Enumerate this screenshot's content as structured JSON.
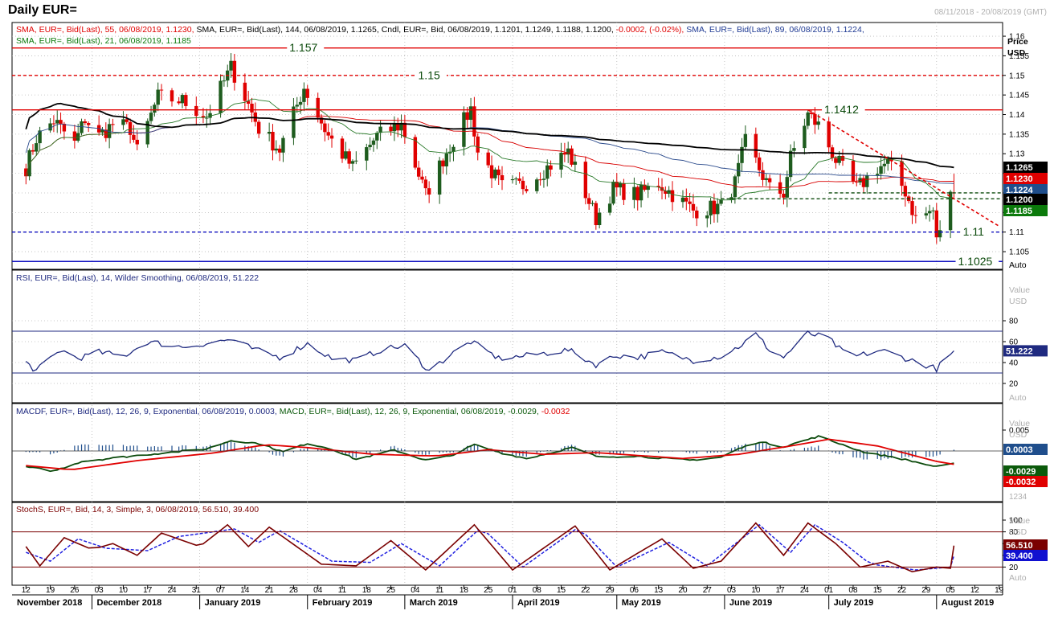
{
  "window": {
    "title": "Daily EUR=",
    "date_range": "08/11/2018 - 20/08/2019 (GMT)"
  },
  "legends": {
    "price_line1": [
      {
        "text": "SMA, EUR=, Bid(Last),  55, 06/08/2019, 1.1230,",
        "color": "#e00000"
      },
      {
        "text": "SMA, EUR=, Bid(Last),  144, 06/08/2019, 1.1265,",
        "color": "#000000"
      },
      {
        "text": "Cndl, EUR=, Bid, 06/08/2019, 1.1201, 1.1249, 1.1188, 1.1200,",
        "color": "#000000"
      },
      {
        "text": "-0.0002, (-0.02%),",
        "color": "#e00000"
      },
      {
        "text": "SMA, EUR=, Bid(Last),  89, 06/08/2019, 1.1224,",
        "color": "#1f3a93"
      }
    ],
    "price_line2": "SMA, EUR=, Bid(Last),  21, 06/08/2019, 1.1185",
    "rsi": "RSI, EUR=, Bid(Last),  14, Wilder Smoothing, 06/08/2019, 51.222",
    "macd": [
      {
        "text": "MACDF, EUR=, Bid(Last),  12, 26, 9, Exponential, 06/08/2019, 0.0003,",
        "color": "#1f2a80"
      },
      {
        "text": "MACD, EUR=, Bid(Last),  12, 26, 9, Exponential, 06/08/2019,",
        "color": "#0b5a0b"
      },
      {
        "text": "-0.0029,",
        "color": "#0b5a0b"
      },
      {
        "text": "-0.0032",
        "color": "#e00000"
      }
    ],
    "stoch": "StochS, EUR=, Bid,  14, 3, Simple, 3, 06/08/2019, 56.510, 39.400"
  },
  "axis_labels": {
    "price_header": [
      "Price",
      "USD"
    ],
    "value_header": [
      "Value",
      "USD"
    ],
    "auto": "Auto"
  },
  "price_ticks": [
    "1.16",
    "1.155",
    "1.15",
    "1.145",
    "1.14",
    "1.135",
    "1.13",
    "1.125",
    "1.12",
    "1.115",
    "1.11",
    "1.105"
  ],
  "rsi_ticks": [
    "80",
    "60",
    "40",
    "20"
  ],
  "macd_ticks": [
    "0.005",
    "1234"
  ],
  "stoch_ticks": [
    "100",
    "80",
    "60",
    "40",
    "20"
  ],
  "tags": {
    "sma144": {
      "text": "1.1265",
      "bg": "#000000",
      "fg": "#ffffff"
    },
    "sma55": {
      "text": "1.1230",
      "bg": "#e00000",
      "fg": "#ffffff"
    },
    "sma89": {
      "text": "1.1224",
      "bg": "#1f4e8c",
      "fg": "#ffffff"
    },
    "close": {
      "text": "1.1200",
      "bg": "#000000",
      "fg": "#ffffff"
    },
    "sma21": {
      "text": "1.1185",
      "bg": "#0b7a0b",
      "fg": "#ffffff"
    },
    "rsi": {
      "text": "51.222",
      "bg": "#1f2a80",
      "fg": "#ffffff"
    },
    "macdf": {
      "text": "0.0003",
      "bg": "#1f4e8c",
      "fg": "#ffffff"
    },
    "macd": {
      "text": "-0.0029",
      "bg": "#0b5a0b",
      "fg": "#ffffff"
    },
    "signal": {
      "text": "-0.0032",
      "bg": "#e00000",
      "fg": "#ffffff"
    },
    "stoch_k": {
      "text": "56.510",
      "bg": "#7a0000",
      "fg": "#ffffff"
    },
    "stoch_d": {
      "text": "39.400",
      "bg": "#1010d0",
      "fg": "#ffffff"
    }
  },
  "level_labels": {
    "l1157": "1.157",
    "l115": "1.15",
    "l11412": "1.1412",
    "l111": "1.11",
    "l11025": "1.1025"
  },
  "x_axis": {
    "days": [
      "12",
      "19",
      "26",
      "03",
      "10",
      "17",
      "24",
      "31",
      "07",
      "14",
      "21",
      "28",
      "04",
      "11",
      "18",
      "25",
      "04",
      "11",
      "18",
      "25",
      "01",
      "08",
      "15",
      "22",
      "29",
      "06",
      "13",
      "20",
      "27",
      "03",
      "10",
      "17",
      "24",
      "01",
      "08",
      "15",
      "22",
      "29",
      "05",
      "12",
      "19"
    ],
    "months": [
      "November 2018",
      "December 2018",
      "January 2019",
      "February 2019",
      "March 2019",
      "April 2019",
      "May 2019",
      "June 2019",
      "July 2019",
      "August 2019"
    ]
  },
  "colors": {
    "up": "#1e5c1e",
    "down": "#e00000",
    "sma144": "#000000",
    "sma55": "#d80000",
    "sma89": "#2a4a8c",
    "sma21": "#2a7a2a",
    "level": "#e00000",
    "support": "#1010c0",
    "rsi": "#1f2a80",
    "macd": "#0b4a0b",
    "signal": "#e00000",
    "hist": "#1f4e8c",
    "stoch_k": "#7a0000",
    "stoch_d": "#2020e0",
    "grid": "#b8b8b8"
  },
  "chart_data": [
    {
      "type": "candlestick",
      "title": "Daily EUR=",
      "ylabel": "Price USD",
      "ylim": [
        1.1005,
        1.1635
      ],
      "x_range": [
        "08/11/2018",
        "20/08/2019"
      ],
      "anchors_close": [
        [
          "2018-11-12",
          1.1265
        ],
        [
          "2018-11-15",
          1.134
        ],
        [
          "2018-11-20",
          1.1385
        ],
        [
          "2018-11-26",
          1.1325
        ],
        [
          "2018-11-29",
          1.139
        ],
        [
          "2018-12-03",
          1.1345
        ],
        [
          "2018-12-07",
          1.1375
        ],
        [
          "2018-12-12",
          1.1365
        ],
        [
          "2018-12-14",
          1.1305
        ],
        [
          "2018-12-20",
          1.1445
        ],
        [
          "2018-12-27",
          1.1435
        ],
        [
          "2019-01-03",
          1.1395
        ],
        [
          "2019-01-10",
          1.152
        ],
        [
          "2019-01-14",
          1.1445
        ],
        [
          "2019-01-18",
          1.1365
        ],
        [
          "2019-01-24",
          1.131
        ],
        [
          "2019-01-31",
          1.147
        ],
        [
          "2019-02-07",
          1.1345
        ],
        [
          "2019-02-14",
          1.1265
        ],
        [
          "2019-02-21",
          1.1345
        ],
        [
          "2019-02-28",
          1.1375
        ],
        [
          "2019-03-07",
          1.1195
        ],
        [
          "2019-03-13",
          1.1305
        ],
        [
          "2019-03-20",
          1.1415
        ],
        [
          "2019-03-22",
          1.1305
        ],
        [
          "2019-03-29",
          1.1215
        ],
        [
          "2019-04-04",
          1.122
        ],
        [
          "2019-04-11",
          1.1265
        ],
        [
          "2019-04-17",
          1.1305
        ],
        [
          "2019-04-25",
          1.1135
        ],
        [
          "2019-04-30",
          1.121
        ],
        [
          "2019-05-07",
          1.1195
        ],
        [
          "2019-05-13",
          1.1225
        ],
        [
          "2019-05-23",
          1.1155
        ],
        [
          "2019-05-31",
          1.1165
        ],
        [
          "2019-06-04",
          1.1225
        ],
        [
          "2019-06-07",
          1.133
        ],
        [
          "2019-06-14",
          1.121
        ],
        [
          "2019-06-18",
          1.12
        ],
        [
          "2019-06-20",
          1.129
        ],
        [
          "2019-06-25",
          1.14
        ],
        [
          "2019-06-28",
          1.1372
        ],
        [
          "2019-07-03",
          1.1285
        ],
        [
          "2019-07-09",
          1.121
        ],
        [
          "2019-07-15",
          1.1265
        ],
        [
          "2019-07-18",
          1.1275
        ],
        [
          "2019-07-23",
          1.1205
        ],
        [
          "2019-07-26",
          1.1135
        ],
        [
          "2019-07-31",
          1.1155
        ],
        [
          "2019-08-01",
          1.1075
        ],
        [
          "2019-08-02",
          1.1105
        ],
        [
          "2019-08-05",
          1.1203
        ],
        [
          "2019-08-06",
          1.12
        ]
      ],
      "last_candle": {
        "date": "2019-08-06",
        "open": 1.1201,
        "high": 1.1249,
        "low": 1.1188,
        "close": 1.12
      },
      "series": [
        {
          "name": "SMA 144",
          "value": 1.1265
        },
        {
          "name": "SMA 55",
          "value": 1.123
        },
        {
          "name": "SMA 89",
          "value": 1.1224
        },
        {
          "name": "SMA 21",
          "value": 1.1185
        }
      ],
      "levels": [
        {
          "value": 1.157,
          "style": "solid",
          "label": "1.157"
        },
        {
          "value": 1.15,
          "style": "dashed",
          "label": "1.15"
        },
        {
          "value": 1.1412,
          "style": "solid",
          "label": "1.1412"
        },
        {
          "value": 1.1185,
          "style": "dashed"
        },
        {
          "value": 1.12,
          "style": "dashed"
        },
        {
          "value": 1.11,
          "style": "dashed",
          "label": "1.11"
        },
        {
          "value": 1.1025,
          "style": "solid",
          "label": "1.1025"
        }
      ],
      "trendline": {
        "from": [
          "2019-06-25",
          1.1412
        ],
        "to": [
          "2019-08-19",
          1.1115
        ],
        "style": "dashed"
      }
    },
    {
      "type": "line",
      "title": "RSI 14",
      "ylim": [
        0,
        100
      ],
      "levels": [
        70,
        30
      ],
      "anchors": [
        [
          "2018-11-12",
          40
        ],
        [
          "2018-11-15",
          32
        ],
        [
          "2018-11-22",
          52
        ],
        [
          "2018-11-27",
          44
        ],
        [
          "2018-12-03",
          50
        ],
        [
          "2018-12-10",
          46
        ],
        [
          "2018-12-17",
          60
        ],
        [
          "2018-12-27",
          55
        ],
        [
          "2019-01-10",
          62
        ],
        [
          "2019-01-17",
          52
        ],
        [
          "2019-01-24",
          45
        ],
        [
          "2019-02-01",
          58
        ],
        [
          "2019-02-08",
          44
        ],
        [
          "2019-02-15",
          42
        ],
        [
          "2019-02-22",
          52
        ],
        [
          "2019-03-01",
          56
        ],
        [
          "2019-03-08",
          32
        ],
        [
          "2019-03-14",
          47
        ],
        [
          "2019-03-20",
          60
        ],
        [
          "2019-03-28",
          44
        ],
        [
          "2019-04-04",
          46
        ],
        [
          "2019-04-17",
          52
        ],
        [
          "2019-04-25",
          38
        ],
        [
          "2019-05-01",
          47
        ],
        [
          "2019-05-07",
          45
        ],
        [
          "2019-05-14",
          50
        ],
        [
          "2019-05-23",
          42
        ],
        [
          "2019-05-31",
          46
        ],
        [
          "2019-06-05",
          55
        ],
        [
          "2019-06-10",
          67
        ],
        [
          "2019-06-14",
          52
        ],
        [
          "2019-06-18",
          45
        ],
        [
          "2019-06-25",
          68
        ],
        [
          "2019-07-01",
          63
        ],
        [
          "2019-07-05",
          50
        ],
        [
          "2019-07-09",
          46
        ],
        [
          "2019-07-16",
          52
        ],
        [
          "2019-07-25",
          42
        ],
        [
          "2019-08-01",
          34
        ],
        [
          "2019-08-06",
          51.222
        ]
      ]
    },
    {
      "type": "line",
      "title": "MACD 12,26,9",
      "series": [
        {
          "name": "MACD",
          "last": -0.0029
        },
        {
          "name": "Signal",
          "last": -0.0032
        },
        {
          "name": "MACDF",
          "last": 0.0003
        }
      ],
      "macd_anchors": [
        [
          "2018-11-12",
          -0.0038
        ],
        [
          "2018-11-20",
          -0.0048
        ],
        [
          "2018-11-28",
          -0.0025
        ],
        [
          "2018-12-15",
          -0.001
        ],
        [
          "2019-01-03",
          0.0005
        ],
        [
          "2019-01-10",
          0.0025
        ],
        [
          "2019-01-18",
          0.0018
        ],
        [
          "2019-01-25",
          -0.0002
        ],
        [
          "2019-02-01",
          0.0018
        ],
        [
          "2019-02-08",
          0.0005
        ],
        [
          "2019-02-15",
          -0.002
        ],
        [
          "2019-02-26",
          0.0002
        ],
        [
          "2019-03-07",
          -0.0022
        ],
        [
          "2019-03-14",
          -0.0012
        ],
        [
          "2019-03-21",
          0.0015
        ],
        [
          "2019-03-29",
          -0.0005
        ],
        [
          "2019-04-05",
          -0.0018
        ],
        [
          "2019-04-18",
          0.0008
        ],
        [
          "2019-04-26",
          -0.0015
        ],
        [
          "2019-05-06",
          -0.0012
        ],
        [
          "2019-05-22",
          -0.0022
        ],
        [
          "2019-05-31",
          -0.0015
        ],
        [
          "2019-06-05",
          0.0005
        ],
        [
          "2019-06-11",
          0.0022
        ],
        [
          "2019-06-18",
          0.001
        ],
        [
          "2019-06-28",
          0.0035
        ],
        [
          "2019-07-05",
          0.0015
        ],
        [
          "2019-07-12",
          -0.0005
        ],
        [
          "2019-07-20",
          -0.0015
        ],
        [
          "2019-08-01",
          -0.0038
        ],
        [
          "2019-08-06",
          -0.0029
        ]
      ],
      "signal_anchors": [
        [
          "2018-11-12",
          -0.0035
        ],
        [
          "2018-11-25",
          -0.0045
        ],
        [
          "2018-12-15",
          -0.0022
        ],
        [
          "2019-01-05",
          -0.0005
        ],
        [
          "2019-01-20",
          0.0015
        ],
        [
          "2019-02-01",
          0.0008
        ],
        [
          "2019-02-20",
          -0.0008
        ],
        [
          "2019-03-10",
          -0.0012
        ],
        [
          "2019-03-25",
          0.0003
        ],
        [
          "2019-04-10",
          -0.0008
        ],
        [
          "2019-04-25",
          -0.0004
        ],
        [
          "2019-05-20",
          -0.0018
        ],
        [
          "2019-06-05",
          -0.0008
        ],
        [
          "2019-06-20",
          0.0012
        ],
        [
          "2019-07-01",
          0.0028
        ],
        [
          "2019-07-15",
          0.0012
        ],
        [
          "2019-08-01",
          -0.0025
        ],
        [
          "2019-08-06",
          -0.0032
        ]
      ]
    },
    {
      "type": "line",
      "title": "Stochastic 14,3,3",
      "ylim": [
        0,
        100
      ],
      "levels": [
        80,
        20
      ],
      "k_anchors": [
        [
          "2018-11-12",
          55
        ],
        [
          "2018-11-16",
          22
        ],
        [
          "2018-11-23",
          70
        ],
        [
          "2018-12-01",
          50
        ],
        [
          "2018-12-07",
          60
        ],
        [
          "2018-12-14",
          40
        ],
        [
          "2018-12-21",
          78
        ],
        [
          "2019-01-01",
          55
        ],
        [
          "2019-01-09",
          92
        ],
        [
          "2019-01-15",
          55
        ],
        [
          "2019-01-21",
          88
        ],
        [
          "2019-02-05",
          25
        ],
        [
          "2019-02-15",
          22
        ],
        [
          "2019-02-25",
          65
        ],
        [
          "2019-03-07",
          15
        ],
        [
          "2019-03-21",
          92
        ],
        [
          "2019-04-01",
          15
        ],
        [
          "2019-04-19",
          90
        ],
        [
          "2019-04-29",
          15
        ],
        [
          "2019-05-06",
          40
        ],
        [
          "2019-05-14",
          68
        ],
        [
          "2019-05-23",
          18
        ],
        [
          "2019-05-31",
          30
        ],
        [
          "2019-06-10",
          95
        ],
        [
          "2019-06-18",
          40
        ],
        [
          "2019-06-25",
          95
        ],
        [
          "2019-07-03",
          60
        ],
        [
          "2019-07-10",
          20
        ],
        [
          "2019-07-18",
          30
        ],
        [
          "2019-07-25",
          12
        ],
        [
          "2019-08-01",
          20
        ],
        [
          "2019-08-05",
          18
        ],
        [
          "2019-08-06",
          56.51
        ]
      ],
      "d_anchors": [
        [
          "2018-11-12",
          45
        ],
        [
          "2018-11-19",
          30
        ],
        [
          "2018-11-27",
          68
        ],
        [
          "2018-12-05",
          52
        ],
        [
          "2018-12-17",
          48
        ],
        [
          "2018-12-26",
          72
        ],
        [
          "2019-01-11",
          85
        ],
        [
          "2019-01-18",
          62
        ],
        [
          "2019-01-24",
          82
        ],
        [
          "2019-02-08",
          30
        ],
        [
          "2019-02-19",
          28
        ],
        [
          "2019-02-28",
          60
        ],
        [
          "2019-03-11",
          22
        ],
        [
          "2019-03-23",
          88
        ],
        [
          "2019-04-04",
          20
        ],
        [
          "2019-04-20",
          88
        ],
        [
          "2019-05-01",
          20
        ],
        [
          "2019-05-16",
          62
        ],
        [
          "2019-05-27",
          22
        ],
        [
          "2019-06-11",
          92
        ],
        [
          "2019-06-20",
          45
        ],
        [
          "2019-06-27",
          92
        ],
        [
          "2019-07-05",
          62
        ],
        [
          "2019-07-13",
          25
        ],
        [
          "2019-07-26",
          15
        ],
        [
          "2019-08-05",
          20
        ],
        [
          "2019-08-06",
          39.4
        ]
      ]
    }
  ]
}
